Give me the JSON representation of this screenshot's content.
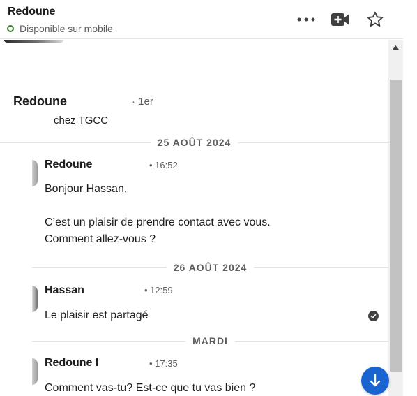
{
  "header": {
    "contact_name": "Redoune",
    "status": "Disponible sur mobile",
    "icons": {
      "more": "more-horizontal-icon",
      "video": "video-camera-icon",
      "star": "star-icon"
    }
  },
  "profile": {
    "name": "Redoune",
    "degree": "· 1er",
    "headline": "chez TGCC"
  },
  "conversation": {
    "dividers": {
      "d1": "25 AOÛT 2024",
      "d2": "26 AOÛT 2024",
      "d3": "MARDI"
    },
    "messages": [
      {
        "sender": "Redoune",
        "time": "• 16:52",
        "text": "Bonjour Hassan,\n\nC’est un plaisir de prendre contact avec vous.\nComment allez-vous ?"
      },
      {
        "sender": "Hassan",
        "time": "• 12:59",
        "text": "Le plaisir est partagé"
      },
      {
        "sender": "Redoune I",
        "time": "• 17:35",
        "text": "Comment vas-tu? Est-ce que tu vas bien ?"
      }
    ]
  },
  "colors": {
    "accent": "#1a64d2",
    "online": "#3a7d2a"
  }
}
